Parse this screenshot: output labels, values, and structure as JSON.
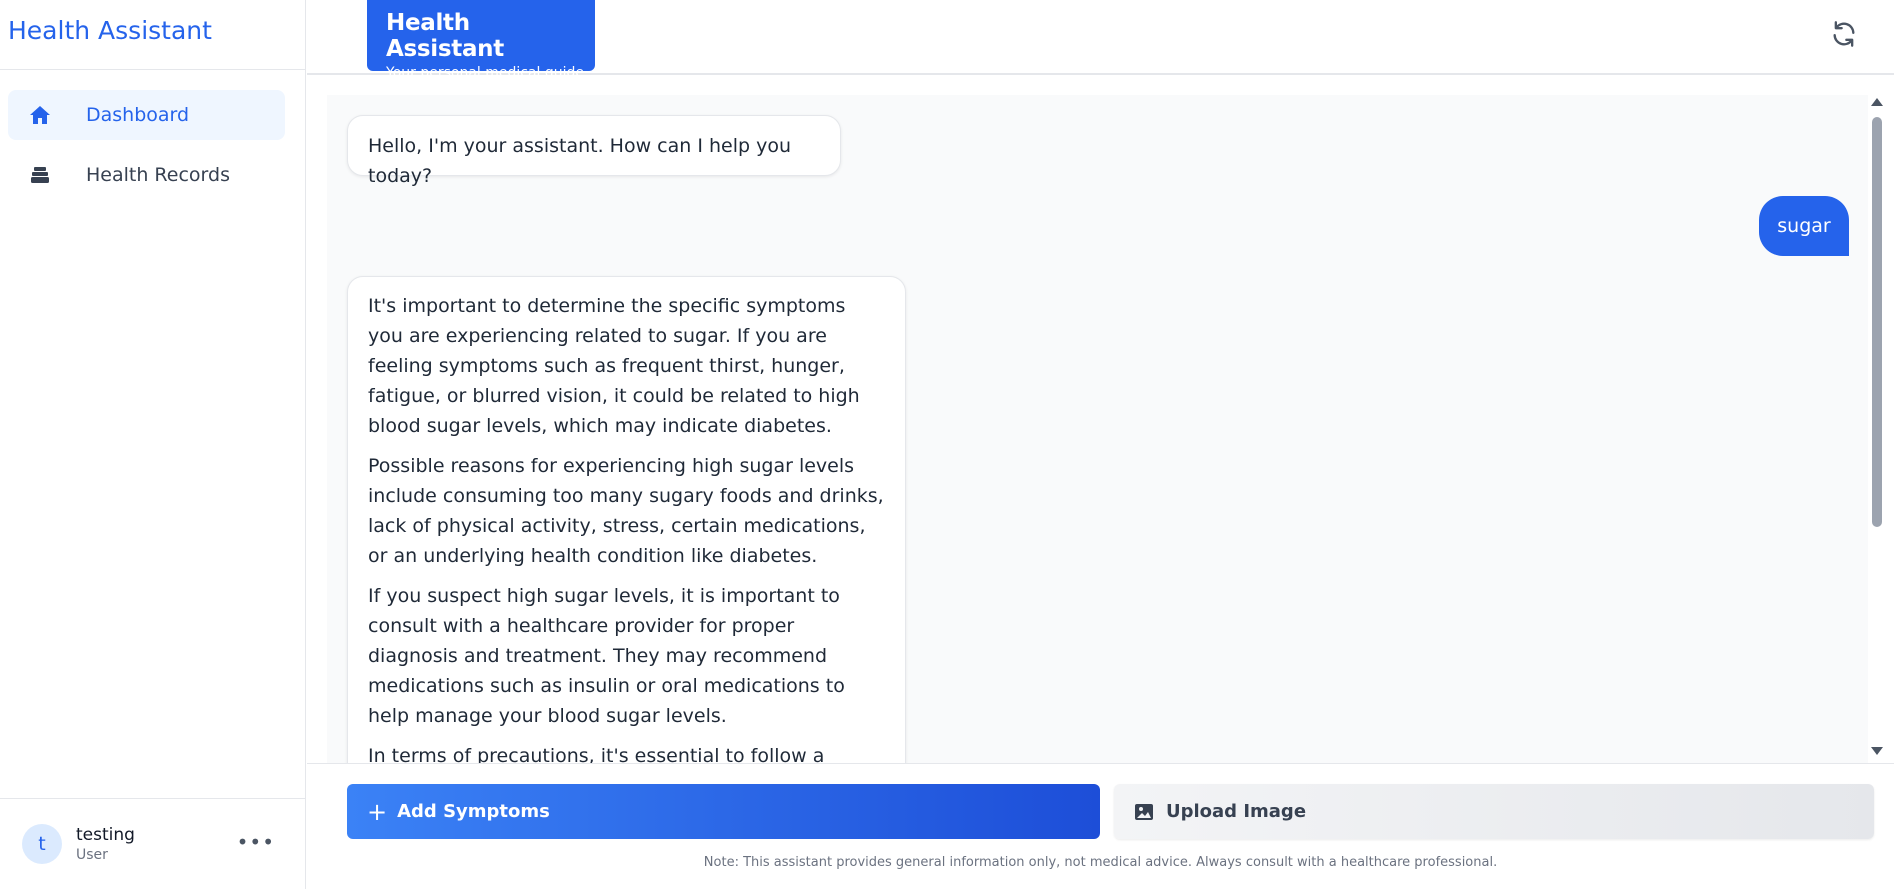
{
  "sidebar": {
    "brand": "Health Assistant",
    "items": [
      {
        "label": "Dashboard",
        "icon": "home-icon",
        "active": true
      },
      {
        "label": "Health Records",
        "icon": "records-icon",
        "active": false
      }
    ],
    "user": {
      "initial": "t",
      "name": "testing",
      "role": "User",
      "more": "•••"
    }
  },
  "header": {
    "title": "Health Assistant",
    "subtitle": "Your personal medical guide",
    "refresh_icon": "refresh-icon"
  },
  "chat": {
    "greeting": "Hello, I'm your assistant. How can I help you today?",
    "user_message": "sugar",
    "answer": [
      "It's important to determine the specific symptoms you are experiencing related to sugar. If you are feeling symptoms such as frequent thirst, hunger, fatigue, or blurred vision, it could be related to high blood sugar levels, which may indicate diabetes.",
      "Possible reasons for experiencing high sugar levels include consuming too many sugary foods and drinks, lack of physical activity, stress, certain medications, or an underlying health condition like diabetes.",
      "If you suspect high sugar levels, it is important to consult with a healthcare provider for proper diagnosis and treatment. They may recommend medications such as insulin or oral medications to help manage your blood sugar levels.",
      "In terms of precautions, it's essential to follow a balanced"
    ]
  },
  "actions": {
    "add_symptoms": "Add Symptoms",
    "upload_image": "Upload Image",
    "note": "Note: This assistant provides general information only, not medical advice. Always consult with a healthcare professional."
  },
  "colors": {
    "accent": "#2563eb",
    "active_bg": "#eff6ff"
  }
}
